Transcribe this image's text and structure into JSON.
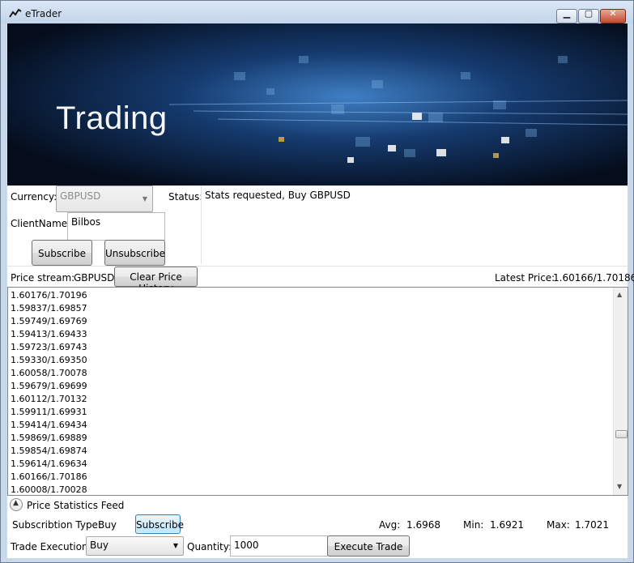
{
  "window": {
    "title": "eTrader",
    "minimize": "▁",
    "maximize": "▢",
    "close": "✕"
  },
  "banner": {
    "text": "Trading"
  },
  "form": {
    "currency_label": "Currency:",
    "currency_value": "GBPUSD",
    "status_label": "Status:",
    "status_text": "Stats requested, Buy GBPUSD",
    "clientname_label": "ClientName:",
    "clientname_value": "Bilbos",
    "subscribe": "Subscribe",
    "unsubscribe": "Unsubscribe"
  },
  "stream": {
    "label": "Price stream:",
    "pair": "GBPUSD",
    "clear": "Clear Price History",
    "latest_label": "Latest Price:",
    "latest_value": "1.60166/1.70186"
  },
  "prices": [
    "1.60176/1.70196",
    "1.59837/1.69857",
    "1.59749/1.69769",
    "1.59413/1.69433",
    "1.59723/1.69743",
    "1.59330/1.69350",
    "1.60058/1.70078",
    "1.59679/1.69699",
    "1.60112/1.70132",
    "1.59911/1.69931",
    "1.59414/1.69434",
    "1.59869/1.69889",
    "1.59854/1.69874",
    "1.59614/1.69634",
    "1.60166/1.70186",
    "1.60008/1.70028"
  ],
  "stats": {
    "header": "Price Statistics Feed",
    "sub_type_label": "Subscribtion Type:",
    "sub_type_value": "Buy",
    "subscribe": "Subscribe",
    "avg_label": "Avg:",
    "avg_value": "1.6968",
    "min_label": "Min:",
    "min_value": "1.6921",
    "max_label": "Max:",
    "max_value": "1.7021"
  },
  "trade": {
    "label": "Trade Execution:",
    "side": "Buy",
    "quantity_label": "Quantity:",
    "quantity_value": "1000",
    "execute": "Execute Trade"
  },
  "icons": {
    "app": "chart-line-icon",
    "expander": "chevron-up-icon"
  },
  "colors": {
    "title_bar": "#c9d8ea",
    "banner_dark": "#050d1c",
    "banner_light": "#3f7fc4",
    "focus_button": "#bee6fd"
  }
}
